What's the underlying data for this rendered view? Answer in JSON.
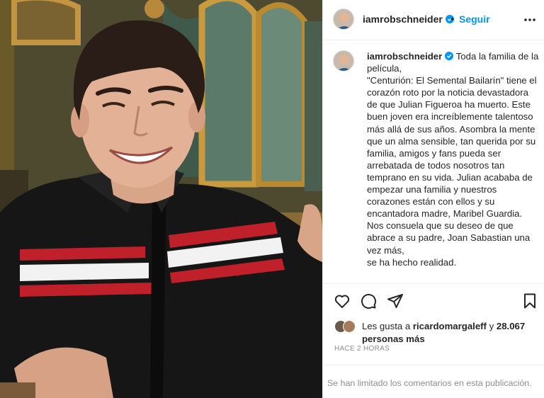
{
  "post": {
    "photo_alt": "photo",
    "author": {
      "username": "iamrobschneider",
      "verified": true,
      "follow_label": "Seguir",
      "separator": "•"
    },
    "caption": {
      "username": "iamrobschneider",
      "text": "Toda la familia de la película,\n\"Centurión: El Semental Bailarín\" tiene el corazón roto por la noticia devastadora de que Julian Figueroa ha muerto. Este buen joven era increíblemente talentoso más allá de sus años. Asombra la mente que un alma sensible, tan querida por su familia, amigos y fans pueda ser arrebatada de todos nosotros tan temprano en su vida. Julian acababa de empezar una familia y nuestros corazones están con ellos y su encantadora madre, Maribel Guardia.\nNos consuela que su deseo de que abrace a su padre, Joan Sabastian una vez más,\nse ha hecho realidad."
    },
    "actions": [
      "heart-icon",
      "comment-icon",
      "share-icon",
      "bookmark-icon"
    ],
    "likes": {
      "prefix": "Les gusta a",
      "user": "ricardomargaleff",
      "middle": "y",
      "count": "28.067",
      "suffix": "personas más"
    },
    "time": "HACE 2 HORAS",
    "comments_notice": "Se han limitado los comentarios en esta publicación."
  },
  "colors": {
    "accent": "#0095f6",
    "verified": "#0095f6",
    "text": "#262626",
    "muted": "#8e8e8e",
    "border": "#efefef"
  }
}
